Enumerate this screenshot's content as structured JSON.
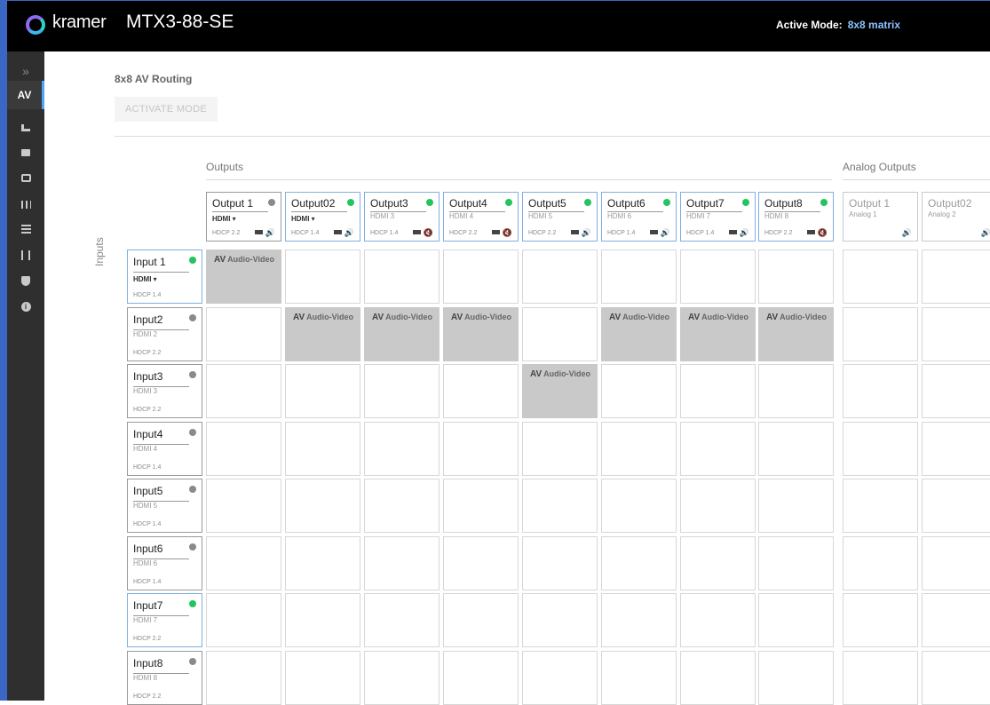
{
  "header": {
    "brand": "kramer",
    "device": "MTX3-88-SE",
    "active_mode_label": "Active Mode:",
    "active_mode_value": "8x8 matrix"
  },
  "sidebar": {
    "items": [
      {
        "label": "»",
        "icon": "expand-icon"
      },
      {
        "label": "AV",
        "active": true
      },
      {
        "icon": "routing-tree-icon"
      },
      {
        "icon": "display-icon"
      },
      {
        "icon": "monitor-icon"
      },
      {
        "icon": "sliders-icon"
      },
      {
        "icon": "grid-settings-icon"
      },
      {
        "icon": "connections-icon"
      },
      {
        "icon": "shield-icon"
      },
      {
        "icon": "info-icon"
      }
    ]
  },
  "page": {
    "heading": "8x8 AV Routing",
    "activate_button": "ACTIVATE MODE",
    "outputs_label": "Outputs",
    "analog_outputs_label": "Analog Outputs",
    "inputs_label": "Inputs",
    "cell_av": "AV",
    "cell_text": "Audio-Video"
  },
  "outputs": [
    {
      "name": "Output 1",
      "signal": "HDMI ▾",
      "selectable": true,
      "hdcp": "HDCP 2.2",
      "status": "gray",
      "audio_muted": false
    },
    {
      "name": "Output02",
      "signal": "HDMI ▾",
      "selectable": true,
      "hdcp": "HDCP 1.4",
      "status": "green",
      "audio_muted": false
    },
    {
      "name": "Output3",
      "signal": "HDMI 3",
      "selectable": false,
      "hdcp": "HDCP 1.4",
      "status": "green",
      "audio_muted": true
    },
    {
      "name": "Output4",
      "signal": "HDMI 4",
      "selectable": false,
      "hdcp": "HDCP 2.2",
      "status": "green",
      "audio_muted": true
    },
    {
      "name": "Output5",
      "signal": "HDMI 5",
      "selectable": false,
      "hdcp": "HDCP 2.2",
      "status": "green",
      "audio_muted": false
    },
    {
      "name": "Output6",
      "signal": "HDMI 6",
      "selectable": false,
      "hdcp": "HDCP 1.4",
      "status": "green",
      "audio_muted": false
    },
    {
      "name": "Output7",
      "signal": "HDMI 7",
      "selectable": false,
      "hdcp": "HDCP 1.4",
      "status": "green",
      "audio_muted": false
    },
    {
      "name": "Output8",
      "signal": "HDMI 8",
      "selectable": false,
      "hdcp": "HDCP 2.2",
      "status": "green",
      "audio_muted": true
    }
  ],
  "analog_outputs": [
    {
      "name": "Output 1",
      "signal": "Analog 1"
    },
    {
      "name": "Output02",
      "signal": "Analog 2"
    }
  ],
  "inputs": [
    {
      "name": "Input 1",
      "signal": "HDMI ▾",
      "selectable": true,
      "hdcp": "HDCP 1.4",
      "status": "green"
    },
    {
      "name": "Input2",
      "signal": "HDMI 2",
      "selectable": false,
      "hdcp": "HDCP 2.2",
      "status": "gray"
    },
    {
      "name": "Input3",
      "signal": "HDMI 3",
      "selectable": false,
      "hdcp": "HDCP 2.2",
      "status": "gray"
    },
    {
      "name": "Input4",
      "signal": "HDMI 4",
      "selectable": false,
      "hdcp": "HDCP 1.4",
      "status": "gray"
    },
    {
      "name": "Input5",
      "signal": "HDMI 5",
      "selectable": false,
      "hdcp": "HDCP 1.4",
      "status": "gray"
    },
    {
      "name": "Input6",
      "signal": "HDMI 6",
      "selectable": false,
      "hdcp": "HDCP 1.4",
      "status": "gray"
    },
    {
      "name": "Input7",
      "signal": "HDMI 7",
      "selectable": false,
      "hdcp": "HDCP 2.2",
      "status": "green"
    },
    {
      "name": "Input8",
      "signal": "HDMI 8",
      "selectable": false,
      "hdcp": "HDCP 2.2",
      "status": "gray"
    }
  ],
  "routing": [
    {
      "input": 0,
      "output": 0
    },
    {
      "input": 1,
      "output": 1
    },
    {
      "input": 1,
      "output": 2
    },
    {
      "input": 1,
      "output": 3
    },
    {
      "input": 1,
      "output": 5
    },
    {
      "input": 1,
      "output": 6
    },
    {
      "input": 1,
      "output": 7
    },
    {
      "input": 2,
      "output": 4
    }
  ]
}
